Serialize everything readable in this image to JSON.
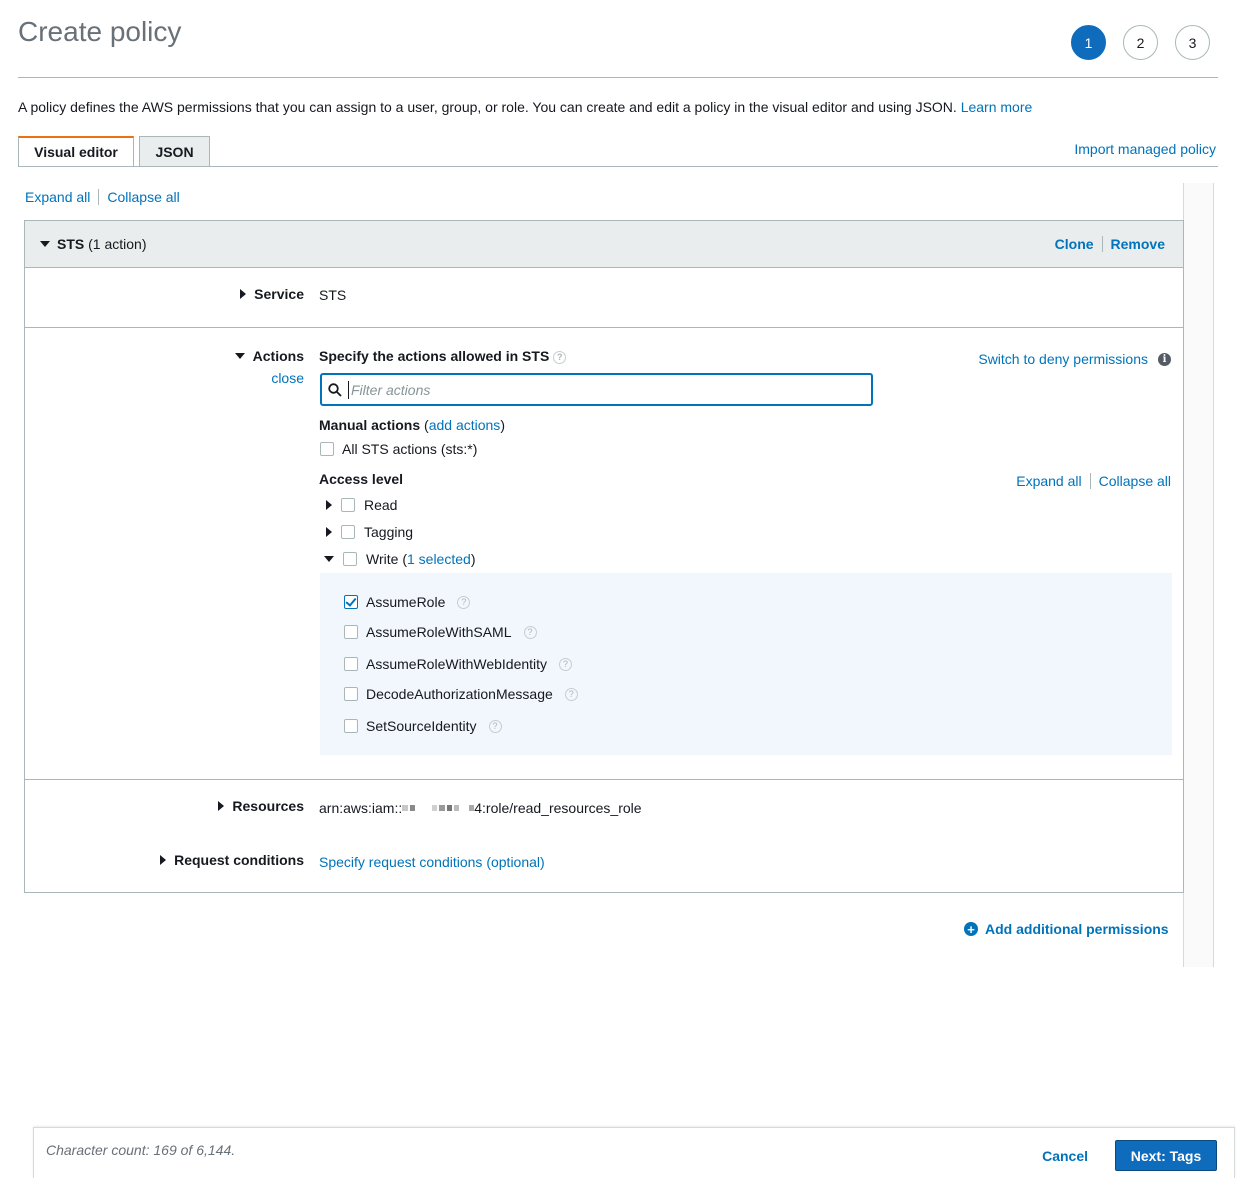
{
  "header": {
    "title": "Create policy",
    "steps": [
      "1",
      "2",
      "3"
    ],
    "active_step": "1"
  },
  "intro": {
    "text": "A policy defines the AWS permissions that you can assign to a user, group, or role. You can create and edit a policy in the visual editor and using JSON.",
    "learn_more": "Learn more"
  },
  "tabs": {
    "visual_editor": "Visual editor",
    "json": "JSON",
    "import_link": "Import managed policy"
  },
  "toolbar": {
    "expand_all": "Expand all",
    "collapse_all": "Collapse all"
  },
  "statement": {
    "service_name": "STS",
    "action_count": "(1 action)",
    "clone": "Clone",
    "remove": "Remove",
    "service_label": "Service",
    "service_value": "STS",
    "actions_label": "Actions",
    "close": "close",
    "actions_title": "Specify the actions allowed in STS",
    "switch_deny": "Switch to deny permissions",
    "filter_placeholder": "Filter actions",
    "manual_actions": "Manual actions",
    "add_actions_open": "(",
    "add_actions": "add actions",
    "add_actions_close": ")",
    "all_actions": "All STS actions (sts:*)",
    "access_level": "Access level",
    "expand_all": "Expand all",
    "collapse_all": "Collapse all",
    "levels": {
      "read": "Read",
      "tagging": "Tagging",
      "write": "Write",
      "write_open": "(",
      "write_selected": "1 selected",
      "write_close": ")"
    },
    "write_actions": [
      {
        "name": "AssumeRole",
        "checked": true
      },
      {
        "name": "AssumeRoleWithSAML",
        "checked": false
      },
      {
        "name": "AssumeRoleWithWebIdentity",
        "checked": false
      },
      {
        "name": "DecodeAuthorizationMessage",
        "checked": false
      },
      {
        "name": "SetSourceIdentity",
        "checked": false
      }
    ],
    "resources_label": "Resources",
    "resources_prefix": "arn:aws:iam::",
    "resources_suffix": "4:role/read_resources_role",
    "conditions_label": "Request conditions",
    "conditions_link": "Specify request conditions (optional)"
  },
  "add_permissions": "Add additional permissions",
  "footer": {
    "char_count": "Character count: 169 of 6,144.",
    "cancel": "Cancel",
    "next": "Next: Tags"
  },
  "colors": {
    "link": "#0073bb",
    "primary": "#0f6cbd",
    "tab_accent": "#ec7211",
    "selected_bg": "#f1f7fc"
  }
}
